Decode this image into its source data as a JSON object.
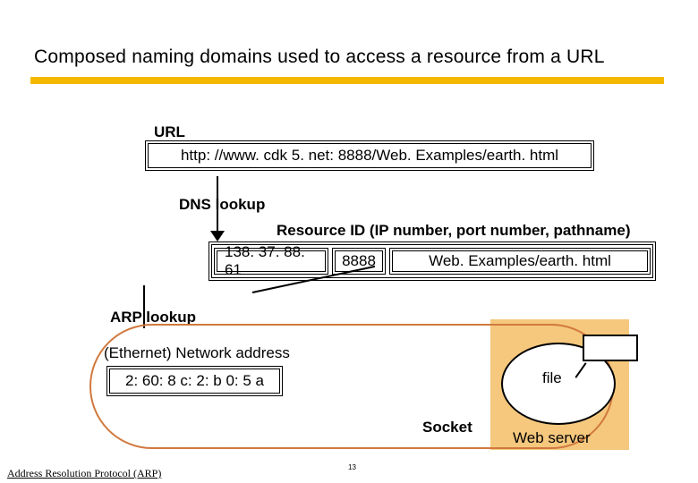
{
  "title": "Composed naming domains used to access a resource from a URL",
  "url": {
    "label": "URL",
    "value": "http: //www. cdk 5. net: 8888/Web. Examples/earth. html"
  },
  "dns": {
    "label": "DNS lookup"
  },
  "resource": {
    "label": "Resource ID (IP number, port number, pathname)",
    "ip": "138. 37. 88. 61",
    "port": "8888",
    "path": "Web. Examples/earth. html"
  },
  "arp": {
    "label": "ARP lookup"
  },
  "ethernet": {
    "label": "(Ethernet) Network address",
    "value": "2: 60: 8 c: 2: b 0: 5 a"
  },
  "socket": "Socket",
  "file": "file",
  "webserver": "Web server",
  "footer": "Address Resolution Protocol (ARP)",
  "page": "13"
}
